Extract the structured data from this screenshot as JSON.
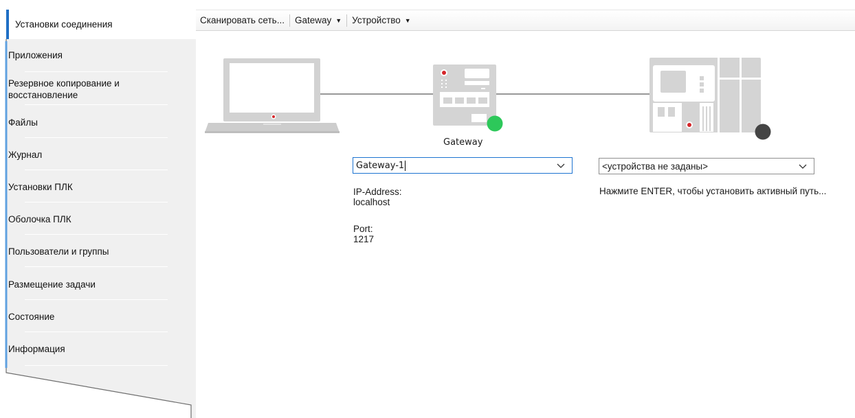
{
  "sidebar": {
    "active": "Установки соединения",
    "items": [
      {
        "label": "Приложения"
      },
      {
        "label": "Резервное копирование и восстановление"
      },
      {
        "label": "Файлы"
      },
      {
        "label": "Журнал"
      },
      {
        "label": "Установки ПЛК"
      },
      {
        "label": "Оболочка ПЛК"
      },
      {
        "label": "Пользователи и группы"
      },
      {
        "label": "Размещение задачи"
      },
      {
        "label": "Состояние"
      },
      {
        "label": "Информация"
      }
    ],
    "accent": "#1f6fc5",
    "panel_color": "#f0f0f0"
  },
  "toolbar": {
    "scan": "Сканировать сеть...",
    "gateway": "Gateway",
    "device": "Устройство"
  },
  "gateway": {
    "caption": "Gateway",
    "selected": "Gateway-1",
    "ip_label": "IP-Address:",
    "ip_value": "localhost",
    "port_label": "Port:",
    "port_value": "1217",
    "status_color": "#2dc85a"
  },
  "device": {
    "selected": "<устройства не заданы>",
    "hint": "Нажмите ENTER, чтобы установить активный путь...",
    "status_color": "#444444"
  },
  "icons": [
    "laptop-icon",
    "gateway-icon",
    "plc-device-icon",
    "chevron-down-icon"
  ]
}
